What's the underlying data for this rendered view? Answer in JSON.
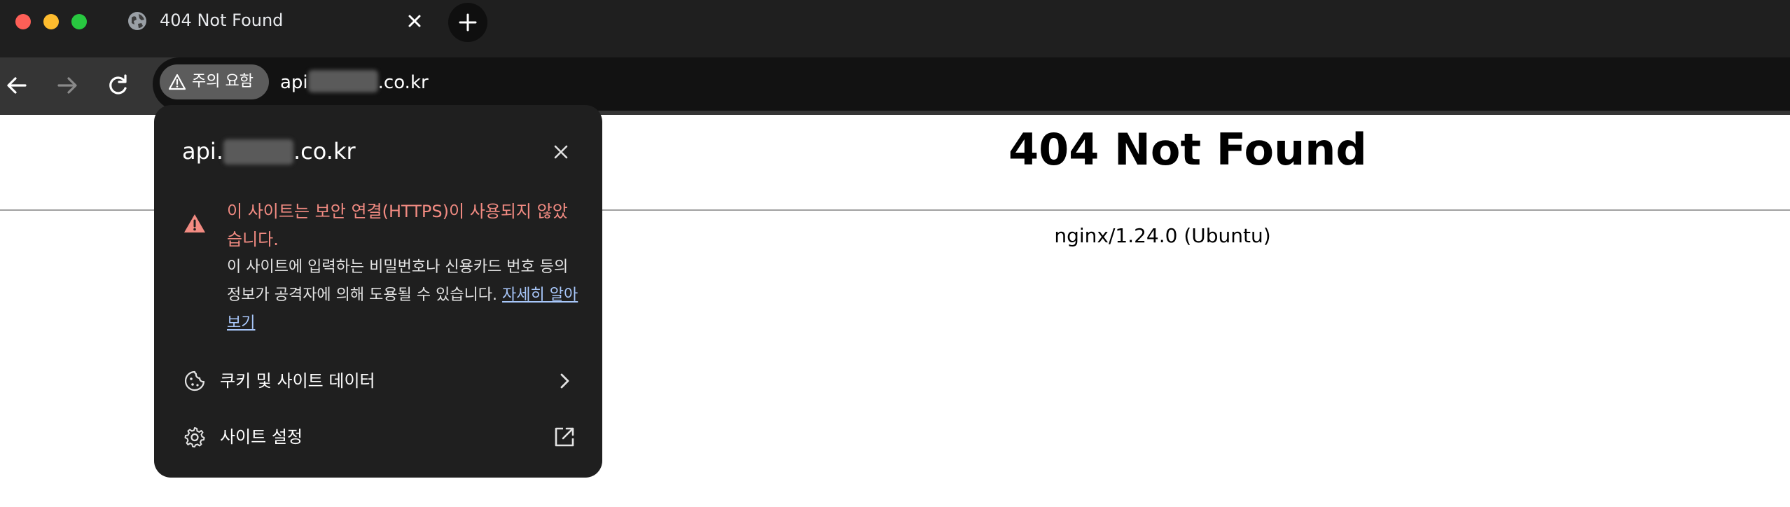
{
  "window": {
    "traffic_lights": [
      "#fe5f57",
      "#febc2e",
      "#28c840"
    ]
  },
  "tab": {
    "title": "404 Not Found",
    "icon": "globe-icon"
  },
  "toolbar": {
    "security_chip_label": "주의 요함",
    "url_prefix": "api",
    "url_suffix": ".co.kr"
  },
  "page": {
    "heading": "404 Not Found",
    "footer": "nginx/1.24.0 (Ubuntu)"
  },
  "popup": {
    "host_prefix": "api.",
    "host_suffix": ".co.kr",
    "warning_title": "이 사이트는 보안 연결(HTTPS)이 사용되지 않았습니다.",
    "warning_body": "이 사이트에 입력하는 비밀번호나 신용카드 번호 등의 정보가 공격자에 의해 도용될 수 있습니다.",
    "learn_more": "자세히 알아보기",
    "cookies_label": "쿠키 및 사이트 데이터",
    "site_settings_label": "사이트 설정",
    "warning_color": "#f28b82",
    "link_color": "#a8c7fa"
  }
}
